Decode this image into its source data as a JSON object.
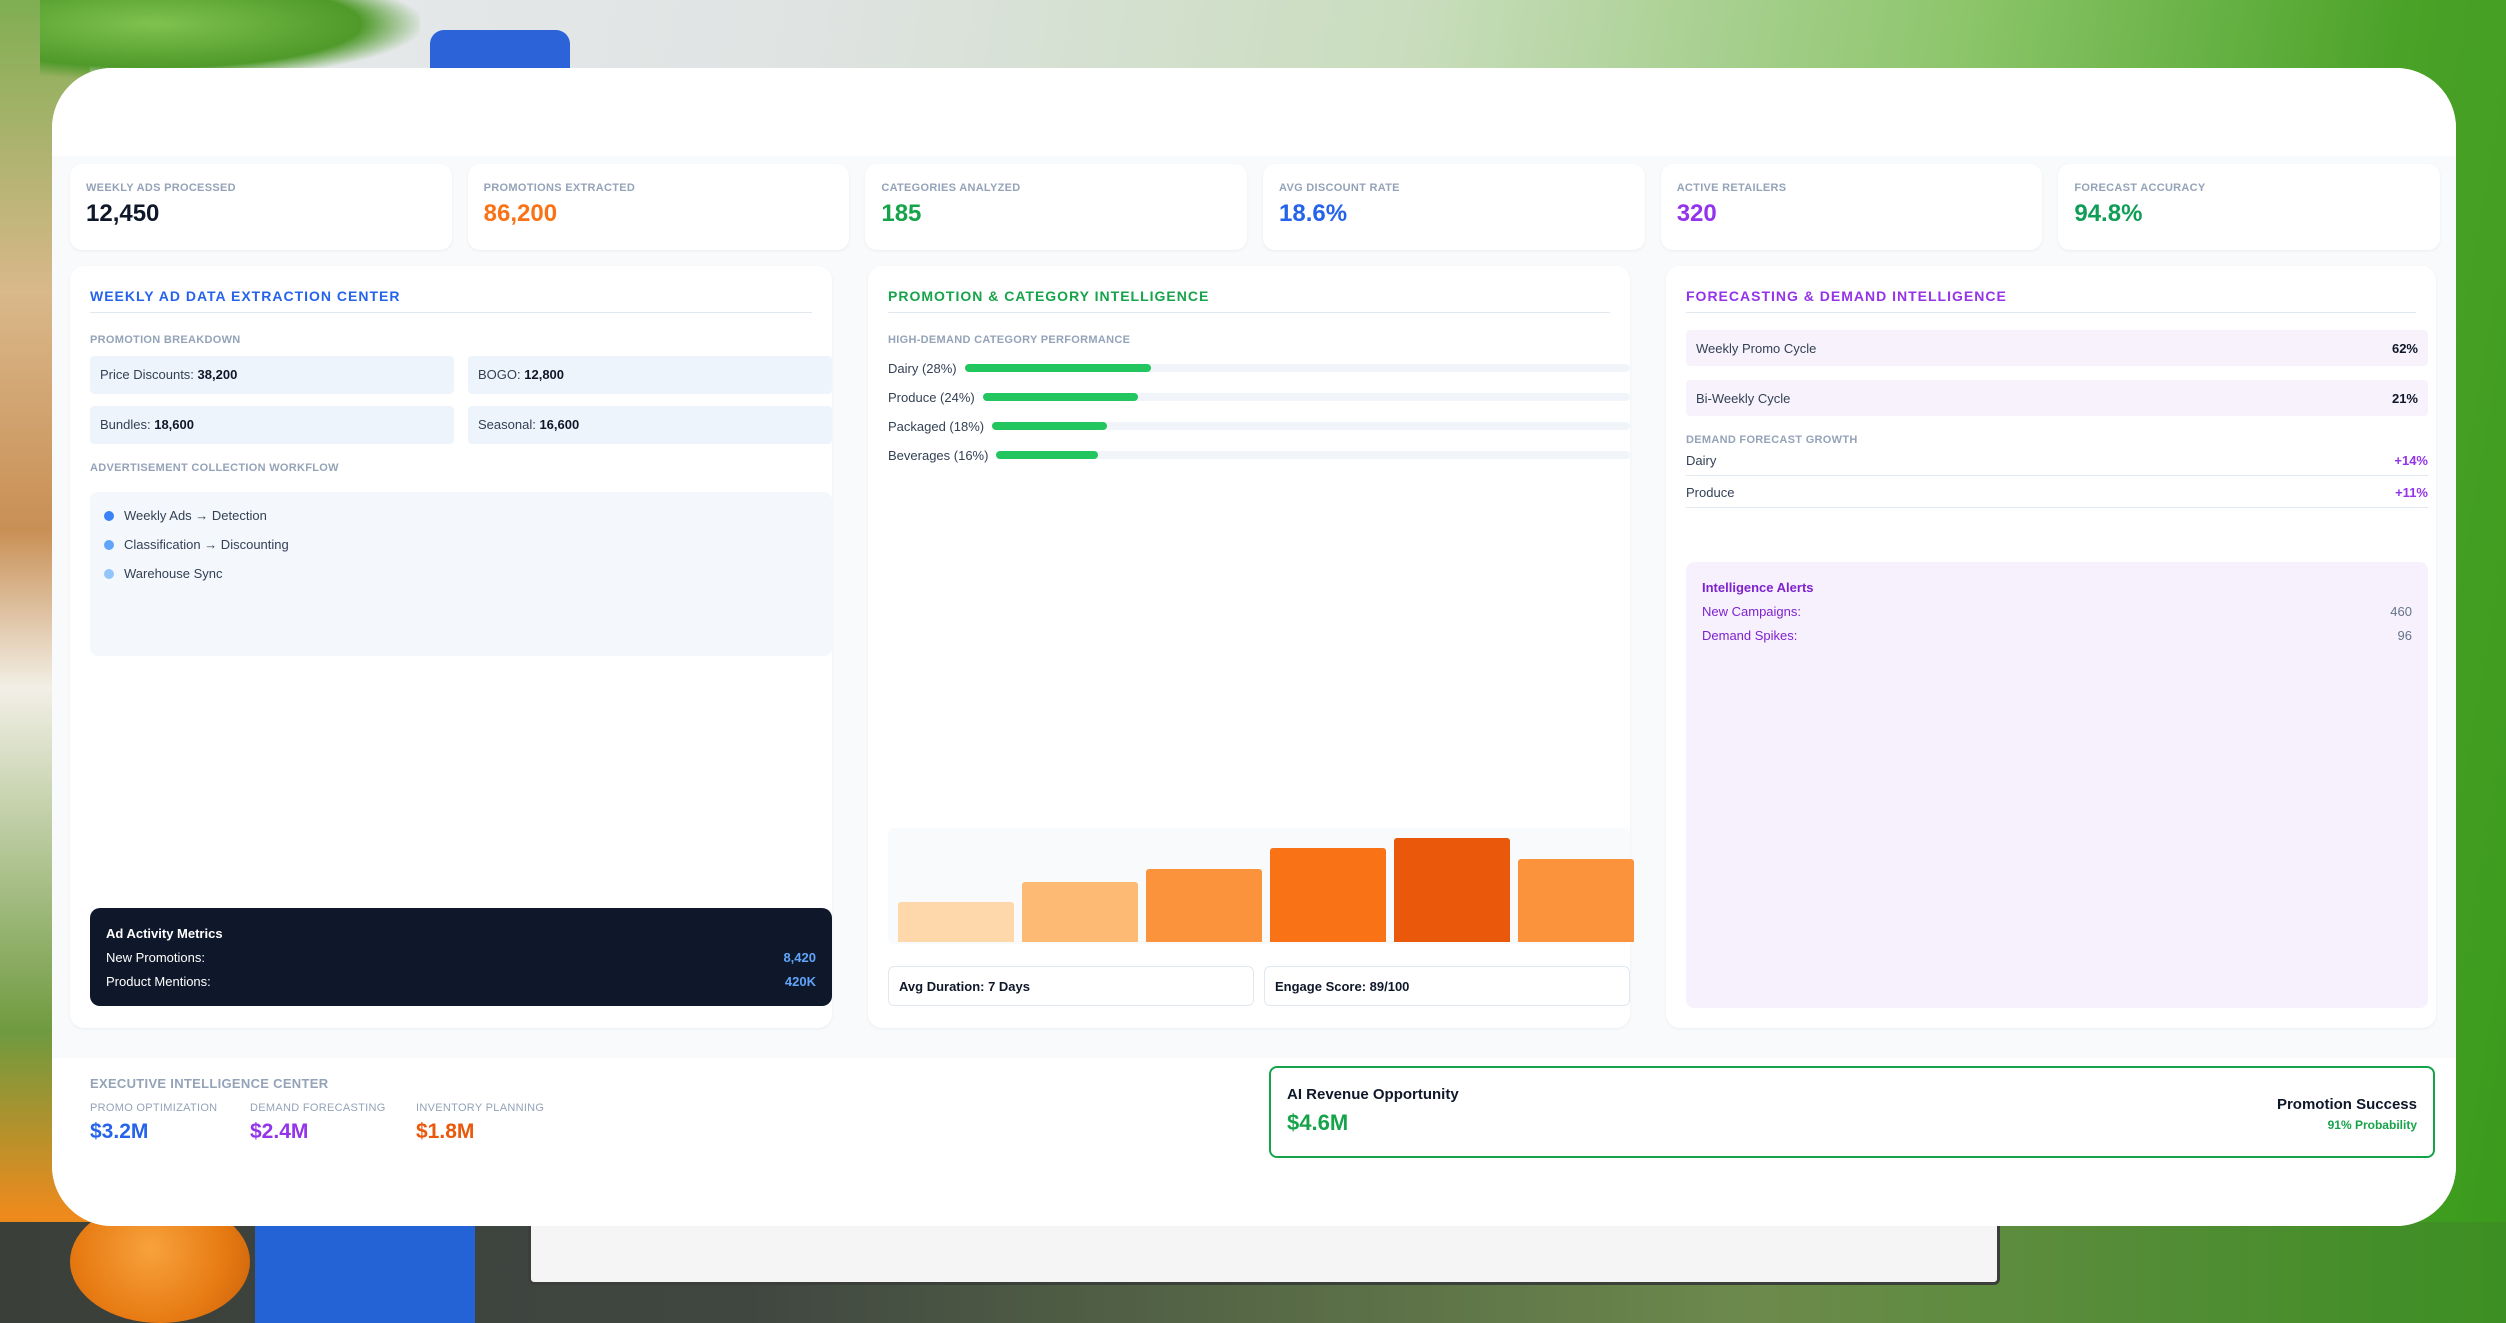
{
  "kpis": [
    {
      "label": "Weekly Ads Processed",
      "value": "12,450",
      "color": "#0f172a"
    },
    {
      "label": "Promotions Extracted",
      "value": "86,200",
      "color": "#f97316"
    },
    {
      "label": "Categories Analyzed",
      "value": "185",
      "color": "#16a34a"
    },
    {
      "label": "Avg Discount Rate",
      "value": "18.6%",
      "color": "#2563eb"
    },
    {
      "label": "Active Retailers",
      "value": "320",
      "color": "#9333ea"
    },
    {
      "label": "Forecast Accuracy",
      "value": "94.8%",
      "color": "#0f9d58"
    }
  ],
  "extraction": {
    "title": "WEEKLY AD DATA EXTRACTION CENTER",
    "title_color": "#2563eb",
    "promo_label": "Promotion Breakdown",
    "promos": [
      {
        "label": "Price Discounts:",
        "value": "38,200"
      },
      {
        "label": "BOGO:",
        "value": "12,800"
      },
      {
        "label": "Bundles:",
        "value": "18,600"
      },
      {
        "label": "Seasonal:",
        "value": "16,600"
      }
    ],
    "workflow_label": "Advertisement Collection Workflow",
    "workflow": [
      {
        "text": "Weekly Ads → Detection",
        "color": "#3b82f6"
      },
      {
        "text": "Classification → Discounting",
        "color": "#60a5fa"
      },
      {
        "text": "Warehouse Sync",
        "color": "#93c5fd"
      }
    ],
    "metrics": {
      "title": "Ad Activity Metrics",
      "rows": [
        {
          "label": "New Promotions:",
          "value": "8,420"
        },
        {
          "label": "Product Mentions:",
          "value": "420K"
        }
      ]
    }
  },
  "intelligence": {
    "title": "PROMOTION & CATEGORY INTELLIGENCE",
    "title_color": "#16a34a",
    "perf_label": "High-Demand Category Performance",
    "categories": [
      {
        "label": "Dairy (28%)",
        "pct": 28
      },
      {
        "label": "Produce (24%)",
        "pct": 24
      },
      {
        "label": "Packaged (18%)",
        "pct": 18
      },
      {
        "label": "Beverages (16%)",
        "pct": 16
      }
    ],
    "columns": [
      {
        "value": 38,
        "color": "#fed7aa"
      },
      {
        "value": 58,
        "color": "#fdba74"
      },
      {
        "value": 70,
        "color": "#fb923c"
      },
      {
        "value": 90,
        "color": "#f97316"
      },
      {
        "value": 100,
        "color": "#ea580c"
      },
      {
        "value": 80,
        "color": "#fb923c"
      }
    ],
    "stats": [
      "Avg Duration: 7 Days",
      "Engage Score: 89/100"
    ]
  },
  "forecasting": {
    "title": "FORECASTING & DEMAND INTELLIGENCE",
    "title_color": "#9333ea",
    "cycles": [
      {
        "label": "Weekly Promo Cycle",
        "value": "62%"
      },
      {
        "label": "Bi-Weekly Cycle",
        "value": "21%"
      }
    ],
    "growth_label": "Demand Forecast Growth",
    "growth": [
      {
        "label": "Dairy",
        "value": "+14%"
      },
      {
        "label": "Produce",
        "value": "+11%"
      }
    ],
    "alerts": {
      "title": "Intelligence Alerts",
      "rows": [
        {
          "label": "New Campaigns:",
          "value": "460"
        },
        {
          "label": "Demand Spikes:",
          "value": "96"
        }
      ]
    }
  },
  "executive": {
    "title": "Executive Intelligence Center",
    "items": [
      {
        "label": "Promo Optimization",
        "value": "$3.2M",
        "color": "#2563eb"
      },
      {
        "label": "Demand Forecasting",
        "value": "$2.4M",
        "color": "#9333ea"
      },
      {
        "label": "Inventory Planning",
        "value": "$1.8M",
        "color": "#ea580c"
      }
    ],
    "ai": {
      "title": "AI Revenue Opportunity",
      "value": "$4.6M",
      "right_title": "Promotion Success",
      "right_sub": "91% Probability"
    }
  }
}
